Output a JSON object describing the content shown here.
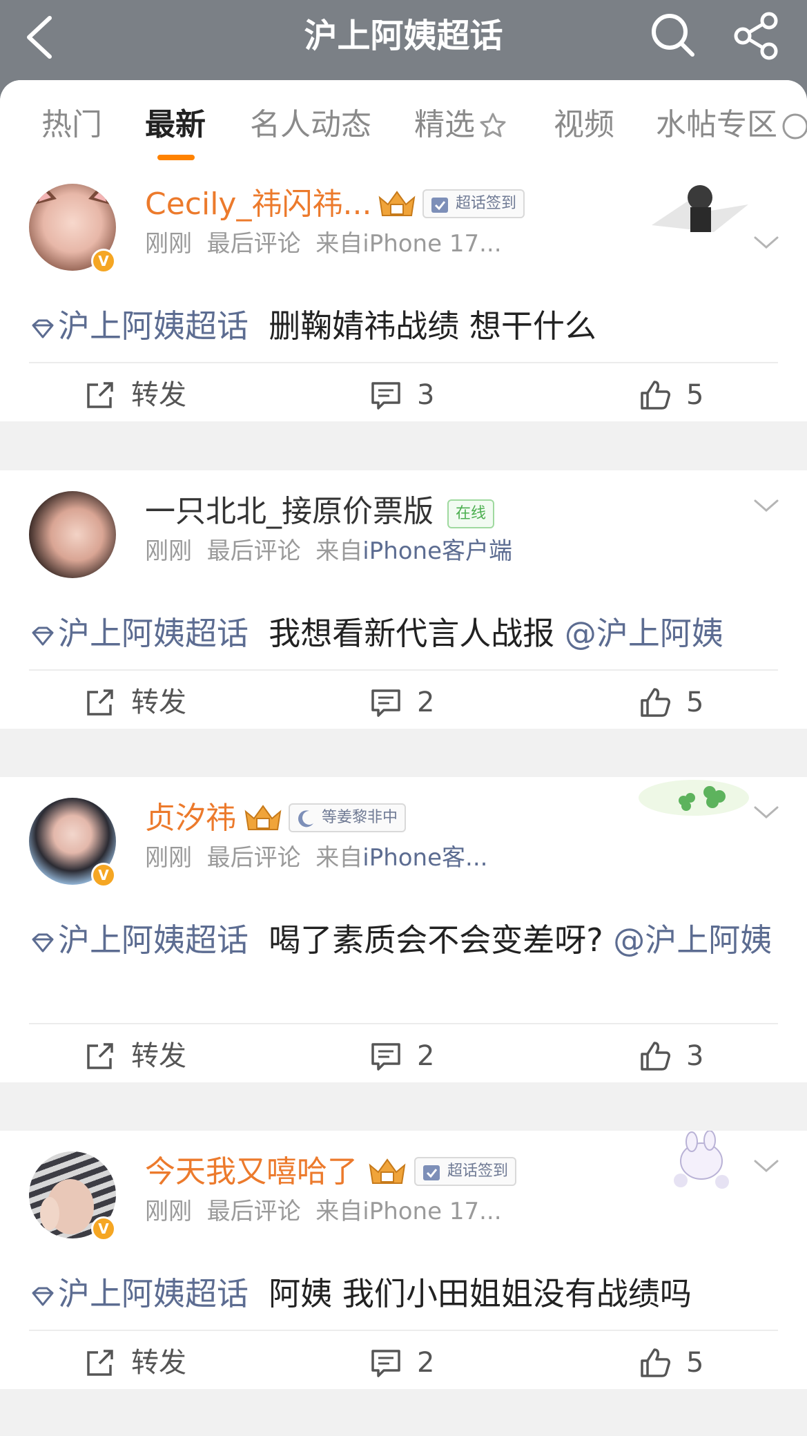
{
  "header": {
    "title": "沪上阿姨超话"
  },
  "tabs": [
    {
      "label": "热门"
    },
    {
      "label": "最新"
    },
    {
      "label": "名人动态"
    },
    {
      "label": "精选"
    },
    {
      "label": "视频"
    },
    {
      "label": "水帖专区"
    }
  ],
  "accent_color": "#ff8200",
  "link_color": "#5c6c91",
  "posts": [
    {
      "username": "Cecily_祎闪祎...",
      "badge": "超话签到",
      "time": "刚刚",
      "last_comment": "最后评论",
      "source_prefix": "来自",
      "source": "iPhone 17...",
      "topic": "沪上阿姨超话",
      "text": "删鞠婧祎战绩 想干什么",
      "repost": "转发",
      "comments": "3",
      "likes": "5"
    },
    {
      "username": "一只北北_接原价票版",
      "badge": "在线",
      "time": "刚刚",
      "last_comment": "最后评论",
      "source_prefix": "来自",
      "source": "iPhone客户端",
      "topic": "沪上阿姨超话",
      "text": "我想看新代言人战报",
      "mention": "@沪上阿姨",
      "repost": "转发",
      "comments": "2",
      "likes": "5"
    },
    {
      "username": "贞汐祎",
      "badge": "等姜黎非中",
      "time": "刚刚",
      "last_comment": "最后评论",
      "source_prefix": "来自",
      "source": "iPhone客...",
      "topic": "沪上阿姨超话",
      "text": "喝了素质会不会变差呀?",
      "mention": "@沪上阿姨",
      "repost": "转发",
      "comments": "2",
      "likes": "3"
    },
    {
      "username": "今天我又嘻哈了",
      "badge": "超话签到",
      "time": "刚刚",
      "last_comment": "最后评论",
      "source_prefix": "来自",
      "source": "iPhone 17...",
      "topic": "沪上阿姨超话",
      "text": "阿姨 我们小田姐姐没有战绩吗",
      "repost": "转发",
      "comments": "2",
      "likes": "5"
    }
  ],
  "icons": {
    "back": "chevron-left-icon",
    "search": "search-icon",
    "share": "share-icon",
    "repost": "repost-icon",
    "comment": "comment-icon",
    "like": "like-icon",
    "topic": "gem-icon",
    "more": "chevron-down-icon",
    "verified": "verified-badge-icon",
    "crown": "crown-icon"
  }
}
